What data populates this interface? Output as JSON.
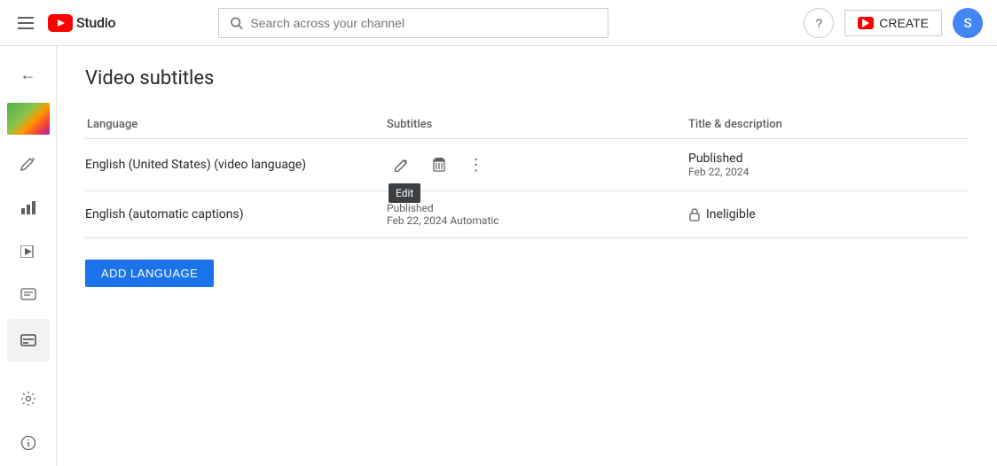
{
  "topbar": {
    "search_placeholder": "Search across your channel",
    "create_label": "CREATE",
    "avatar_letter": "S",
    "studio_label": "Studio"
  },
  "sidebar": {
    "back_icon": "←",
    "edit_icon": "✏",
    "analytics_icon": "▦",
    "video_icon": "▬",
    "comments_icon": "☰",
    "subtitles_icon": "▤",
    "settings_icon": "⚙",
    "info_icon": "ⓘ"
  },
  "page": {
    "title": "Video subtitles"
  },
  "table": {
    "headers": {
      "language": "Language",
      "subtitles": "Subtitles",
      "title_desc": "Title & description"
    },
    "rows": [
      {
        "language": "English (United States) (video language)",
        "has_actions": true,
        "status": "Published",
        "date": "Feb 22, 2024",
        "tooltip": "Edit"
      },
      {
        "language": "English (automatic captions)",
        "has_actions": false,
        "sub_status": "Published",
        "sub_date": "Feb 22, 2024 Automatic",
        "title_status": "Ineligible",
        "is_ineligible": true
      }
    ]
  },
  "buttons": {
    "add_language": "ADD LANGUAGE"
  }
}
